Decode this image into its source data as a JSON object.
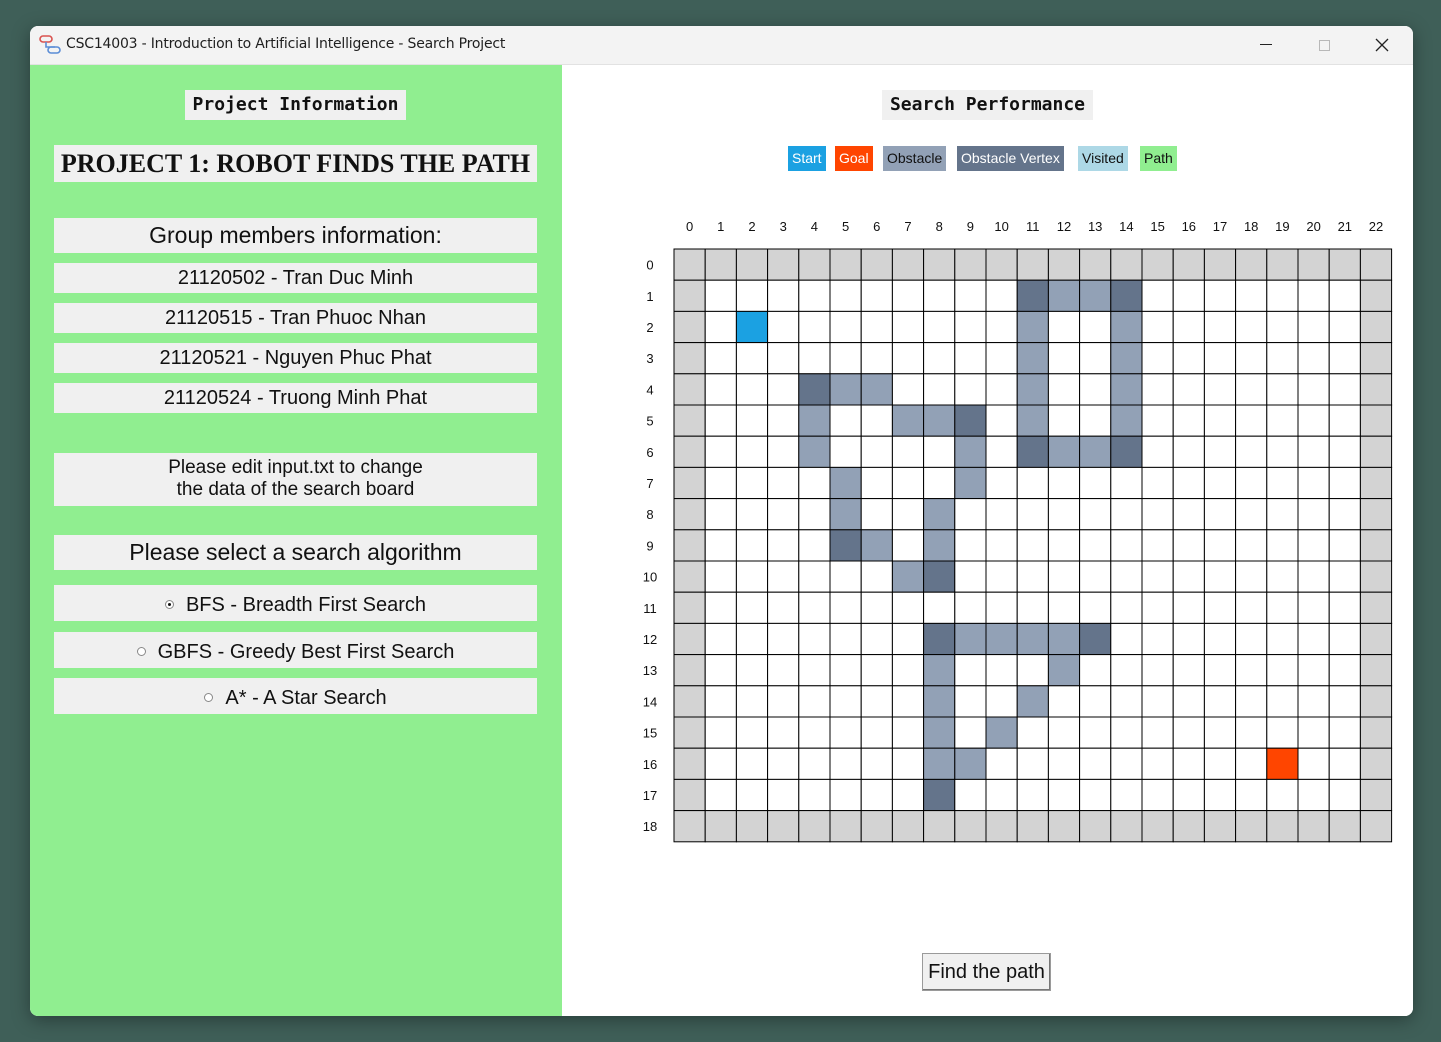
{
  "window": {
    "title": "CSC14003 - Introduction to Artificial Intelligence - Search Project"
  },
  "left_panel": {
    "project_info_title": "Project Information",
    "project_name": "PROJECT 1: ROBOT FINDS THE PATH",
    "members_header": "Group members information:",
    "members": [
      "21120502 - Tran Duc Minh",
      "21120515 - Tran Phuoc Nhan",
      "21120521 - Nguyen Phuc Phat",
      "21120524 - Truong Minh Phat"
    ],
    "note_line1": "Please edit input.txt to change",
    "note_line2": "the data of the search board",
    "algo_header": "Please select a search algorithm",
    "algorithms": [
      {
        "label": "BFS - Breadth First Search",
        "selected": true
      },
      {
        "label": "GBFS - Greedy Best First Search",
        "selected": false
      },
      {
        "label": "A* - A Star Search",
        "selected": false
      }
    ]
  },
  "right_panel": {
    "title": "Search Performance",
    "legend": [
      {
        "label": "Start",
        "bg": "#1ba1e2",
        "fg": "#ffffff"
      },
      {
        "label": "Goal",
        "bg": "#ff4500",
        "fg": "#ffffff"
      },
      {
        "label": "Obstacle",
        "bg": "#92a1b6",
        "fg": "#111111"
      },
      {
        "label": "Obstacle Vertex",
        "bg": "#64748b",
        "fg": "#ffffff"
      },
      {
        "label": "Visited",
        "bg": "#add8e6",
        "fg": "#111111"
      },
      {
        "label": "Path",
        "bg": "#90ee90",
        "fg": "#111111"
      }
    ],
    "find_button": "Find the path"
  },
  "board": {
    "x_labels": [
      "0",
      "1",
      "2",
      "3",
      "4",
      "5",
      "6",
      "7",
      "8",
      "9",
      "10",
      "11",
      "12",
      "13",
      "14",
      "15",
      "16",
      "17",
      "18",
      "19",
      "20",
      "21",
      "22"
    ],
    "y_labels": [
      "0",
      "1",
      "2",
      "3",
      "4",
      "5",
      "6",
      "7",
      "8",
      "9",
      "10",
      "11",
      "12",
      "13",
      "14",
      "15",
      "16",
      "17",
      "18"
    ],
    "colors": {
      "border": "#d3d3d3",
      "empty": "#ffffff",
      "start": "#1ba1e2",
      "goal": "#ff4500",
      "obstacle": "#92a1b6",
      "vertex": "#64748b"
    },
    "start": [
      2,
      2
    ],
    "goal": [
      19,
      16
    ],
    "obstacle_vertices": [
      [
        11,
        1
      ],
      [
        14,
        1
      ],
      [
        11,
        6
      ],
      [
        14,
        6
      ],
      [
        4,
        4
      ],
      [
        9,
        5
      ],
      [
        5,
        9
      ],
      [
        8,
        10
      ],
      [
        8,
        12
      ],
      [
        13,
        12
      ],
      [
        8,
        17
      ]
    ],
    "obstacle_edges": [
      [
        12,
        1
      ],
      [
        13,
        1
      ],
      [
        11,
        2
      ],
      [
        11,
        3
      ],
      [
        11,
        4
      ],
      [
        11,
        5
      ],
      [
        14,
        2
      ],
      [
        14,
        3
      ],
      [
        14,
        4
      ],
      [
        14,
        5
      ],
      [
        12,
        6
      ],
      [
        13,
        6
      ],
      [
        5,
        4
      ],
      [
        6,
        4
      ],
      [
        4,
        5
      ],
      [
        4,
        6
      ],
      [
        7,
        5
      ],
      [
        8,
        5
      ],
      [
        9,
        6
      ],
      [
        9,
        7
      ],
      [
        5,
        7
      ],
      [
        5,
        8
      ],
      [
        6,
        9
      ],
      [
        8,
        8
      ],
      [
        8,
        9
      ],
      [
        7,
        10
      ],
      [
        9,
        12
      ],
      [
        10,
        12
      ],
      [
        11,
        12
      ],
      [
        12,
        12
      ],
      [
        12,
        13
      ],
      [
        11,
        14
      ],
      [
        10,
        15
      ],
      [
        9,
        16
      ],
      [
        8,
        13
      ],
      [
        8,
        14
      ],
      [
        8,
        15
      ],
      [
        8,
        16
      ]
    ]
  }
}
